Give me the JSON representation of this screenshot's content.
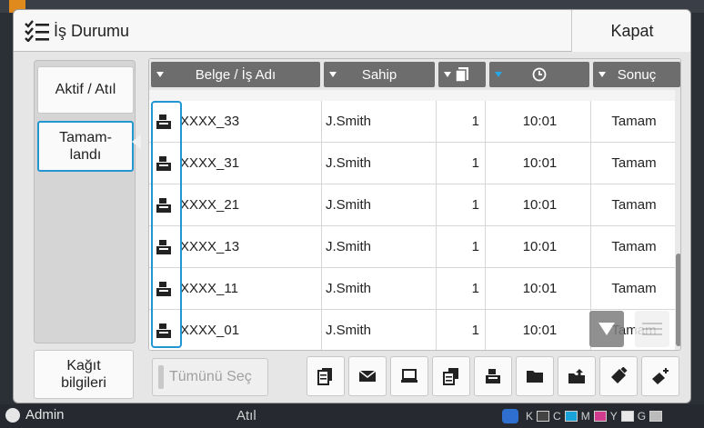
{
  "dialog": {
    "title": "İş Durumu",
    "close_label": "Kapat"
  },
  "left_panel": {
    "active_label": "Aktif / Atıl",
    "completed_label": "Tamam-\nlandı",
    "paper_info_label": "Kağıt\nbilgileri"
  },
  "table": {
    "headers": [
      "Belge / İş Adı",
      "Sahip",
      "copies-icon",
      "clock-icon",
      "Sonuç"
    ],
    "rows": [
      {
        "icon": "print-job-icon",
        "name": "XXXX_33",
        "owner": "J.Smith",
        "count": "1",
        "time": "10:01",
        "result": "Tamam"
      },
      {
        "icon": "print-job-icon",
        "name": "XXXX_31",
        "owner": "J.Smith",
        "count": "1",
        "time": "10:01",
        "result": "Tamam"
      },
      {
        "icon": "print-job-icon",
        "name": "XXXX_21",
        "owner": "J.Smith",
        "count": "1",
        "time": "10:01",
        "result": "Tamam"
      },
      {
        "icon": "print-job-icon",
        "name": "XXXX_13",
        "owner": "J.Smith",
        "count": "1",
        "time": "10:01",
        "result": "Tamam"
      },
      {
        "icon": "print-job-icon",
        "name": "XXXX_11",
        "owner": "J.Smith",
        "count": "1",
        "time": "10:01",
        "result": "Tamam"
      },
      {
        "icon": "print-job-icon",
        "name": "XXXX_01",
        "owner": "J.Smith",
        "count": "1",
        "time": "10:01",
        "result": "Tamam"
      }
    ]
  },
  "footer": {
    "select_all_label": "Tümünü Seç",
    "toolbar_icons": [
      "copy-icon",
      "mail-icon",
      "computer-icon",
      "document-stack-icon",
      "print-icon",
      "folder-icon",
      "export-icon",
      "usb-icon",
      "add-usb-icon"
    ]
  },
  "background": {
    "user": "Admin",
    "status": "Atıl",
    "toner_labels": [
      "K",
      "C",
      "M",
      "Y",
      "G"
    ]
  },
  "colors": {
    "accent": "#2196d3",
    "header_bg": "#6d6d6d",
    "panel_bg": "#e6e6e6"
  }
}
